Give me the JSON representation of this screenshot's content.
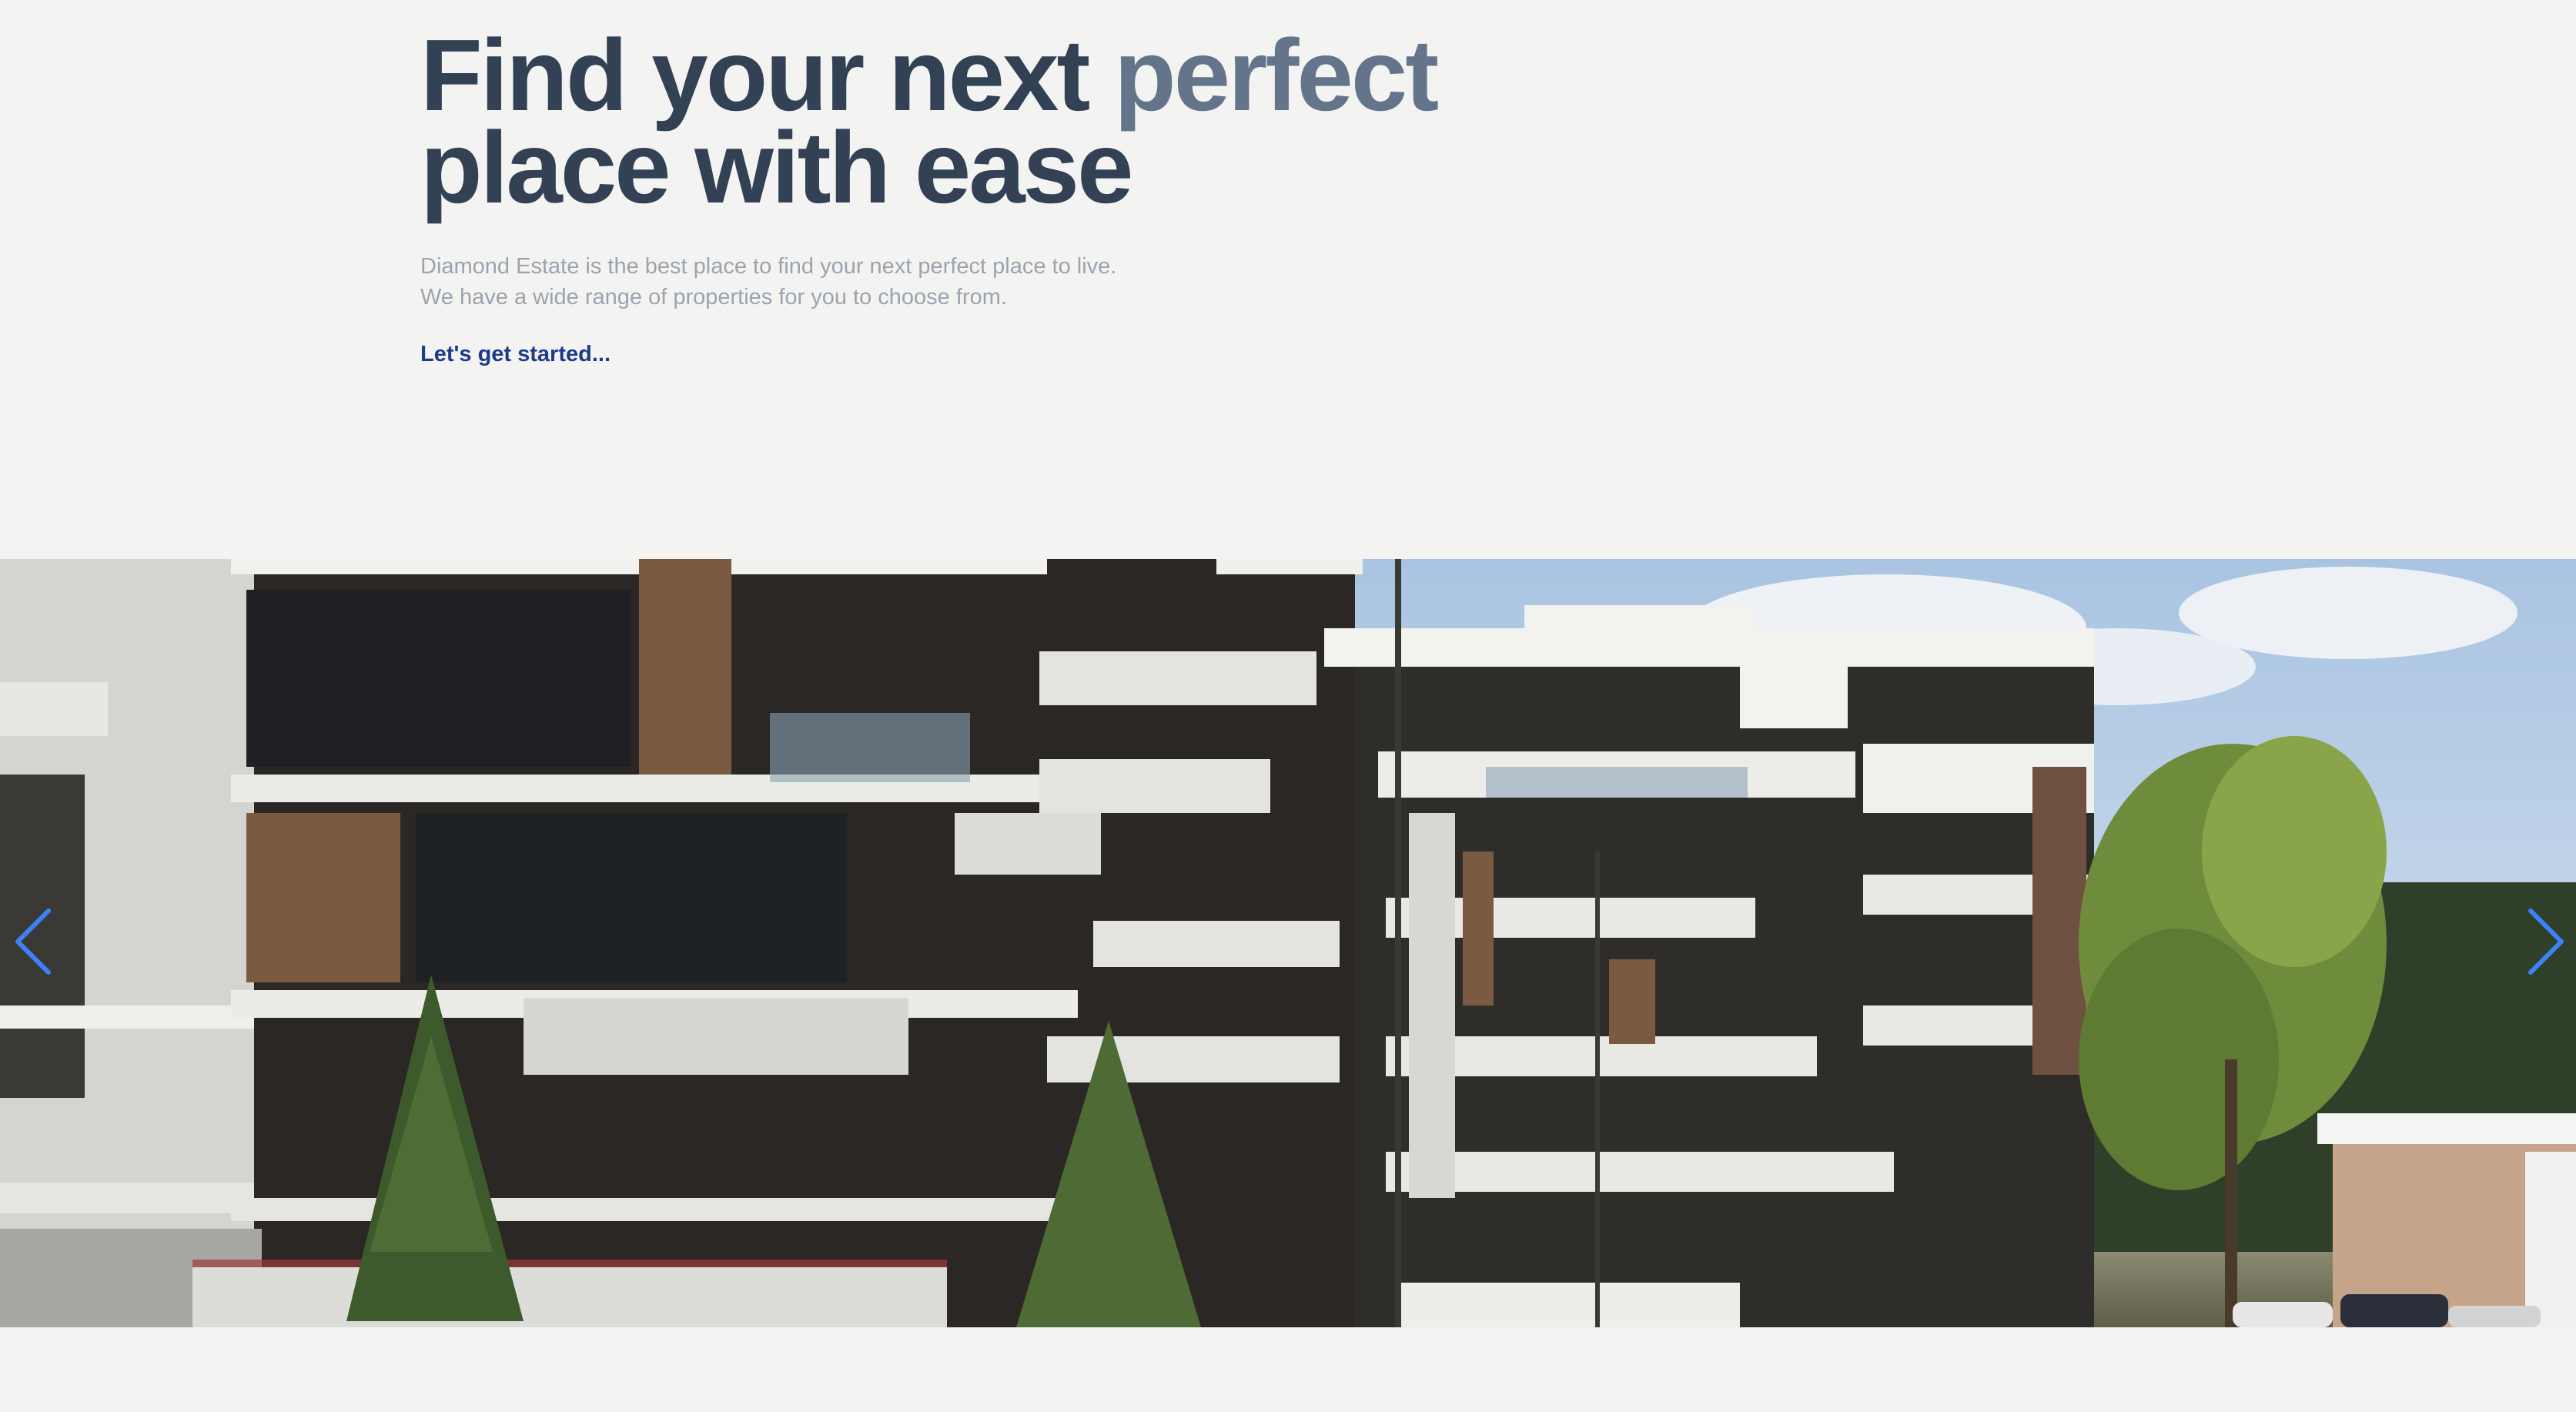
{
  "hero": {
    "headline_part1": "Find your next ",
    "headline_accent": "perfect",
    "headline_part2": "place with ease",
    "subtitle_line1": "Diamond Estate is the best place to find your next perfect place to live.",
    "subtitle_line2": "We have a wide range of properties for you to choose from.",
    "cta_label": "Let's get started..."
  },
  "carousel": {
    "image_name": "modern-apartment-building-photo",
    "prev_icon": "chevron-left-icon",
    "next_icon": "chevron-right-icon"
  },
  "colors": {
    "background": "#f3f4f2",
    "headline": "#334155",
    "headline_accent": "#64748b",
    "subtitle": "#9ca3af",
    "cta": "#1e3a8a",
    "carousel_arrow": "#3b82f6"
  }
}
